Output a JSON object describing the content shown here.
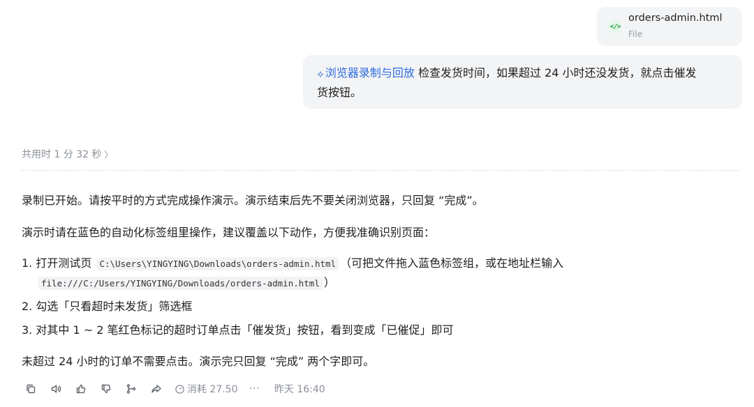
{
  "attachment": {
    "icon": "code-file-icon",
    "icon_glyph": "</>",
    "name": "orders-admin.html",
    "type": "File"
  },
  "user_message": {
    "skill_icon": "layers-icon",
    "skill_label": "浏览器录制与回放",
    "text_line1": " 检查发货时间，如果超过 24 小时还没发货，就点击催发",
    "text_line2": "货按钮。"
  },
  "response": {
    "elapsed": "共用时 1 分 32 秒",
    "para1": "录制已开始。请按平时的方式完成操作演示。演示结束后先不要关闭浏览器，只回复 “完成”。",
    "para2": "演示时请在蓝色的自动化标签组里操作，建议覆盖以下动作，方便我准确识别页面：",
    "steps": {
      "s1_prefix": "1. 打开测试页 ",
      "s1_code1": "C:\\Users\\YINGYING\\Downloads\\orders-admin.html",
      "s1_suffix": "（可把文件拖入蓝色标签组，或在地址栏输入",
      "s1_code2": "file:///C:/Users/YINGYING/Downloads/orders-admin.html",
      "s1_close": "）",
      "s2": "2. 勾选「只看超时未发货」筛选框",
      "s3": "3. 对其中 1 ~ 2 笔红色标记的超时订单点击「催发货」按钮，看到变成「已催促」即可"
    },
    "para3": "未超过 24 小时的订单不需要点击。演示完只回复 “完成” 两个字即可。"
  },
  "footer": {
    "usage": "消耗 27.50",
    "more": "···",
    "timestamp": "昨天 16:40",
    "actions": [
      "copy-icon",
      "speaker-icon",
      "thumbs-up-icon",
      "thumbs-down-icon",
      "branch-icon",
      "share-icon"
    ]
  }
}
